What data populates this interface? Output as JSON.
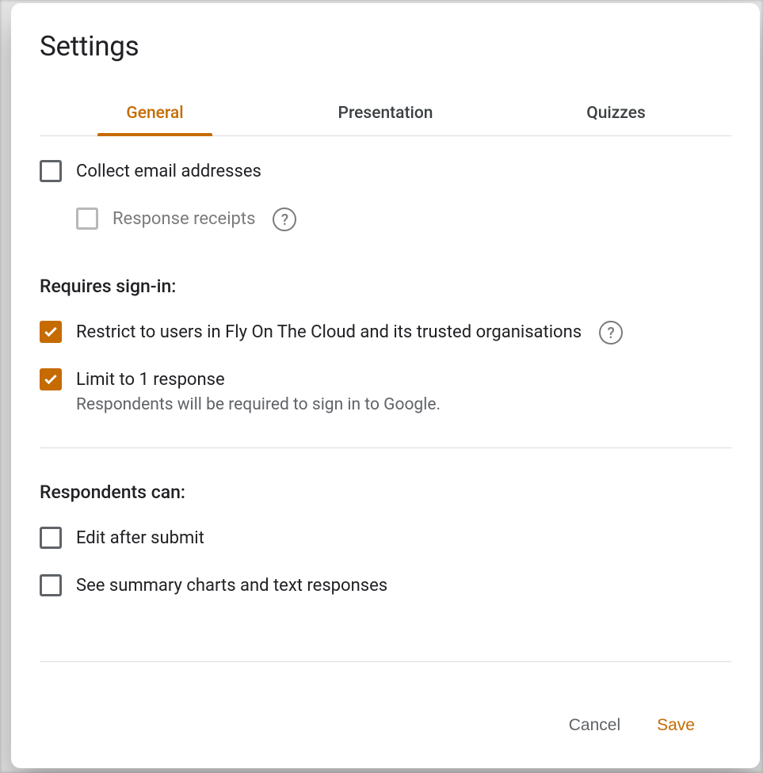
{
  "modal": {
    "title": "Settings",
    "tabs": [
      {
        "label": "General",
        "active": true
      },
      {
        "label": "Presentation",
        "active": false
      },
      {
        "label": "Quizzes",
        "active": false
      }
    ],
    "options": {
      "collectEmail": {
        "label": "Collect email addresses",
        "checked": false
      },
      "responseReceipts": {
        "label": "Response receipts",
        "checked": false,
        "disabled": true,
        "hasHelp": true
      },
      "requiresHeading": "Requires sign-in:",
      "restrict": {
        "label": "Restrict to users in Fly On The Cloud and its trusted organisations",
        "checked": true,
        "hasHelp": true
      },
      "limit": {
        "label": "Limit to 1 response",
        "sub": "Respondents will be required to sign in to Google.",
        "checked": true,
        "highlighted": true
      },
      "respondentsHeading": "Respondents can:",
      "editAfter": {
        "label": "Edit after submit",
        "checked": false
      },
      "seeSummary": {
        "label": "See summary charts and text responses",
        "checked": false
      }
    },
    "footer": {
      "cancel": "Cancel",
      "save": "Save"
    }
  }
}
